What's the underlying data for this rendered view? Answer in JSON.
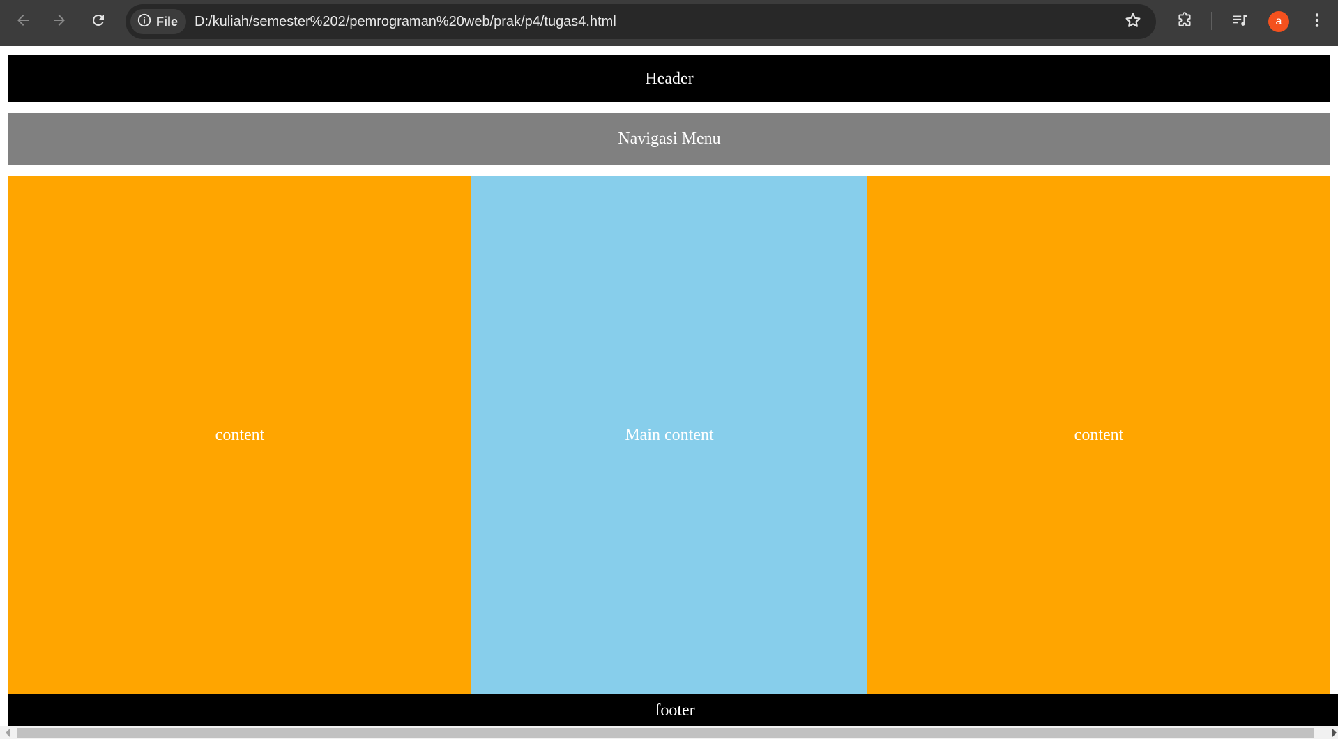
{
  "browser": {
    "site_chip_label": "File",
    "url": "D:/kuliah/semester%202/pemrograman%20web/prak/p4/tugas4.html",
    "avatar_letter": "a",
    "avatar_color": "#f4511e"
  },
  "page": {
    "header_text": "Header",
    "nav_text": "Navigasi Menu",
    "left_content_text": "content",
    "main_content_text": "Main content",
    "right_content_text": "content",
    "footer_text": "footer"
  },
  "colors": {
    "header_bg": "#000000",
    "nav_bg": "#808080",
    "side_content_bg": "#ffa500",
    "main_content_bg": "#87ceeb",
    "footer_bg": "#000000"
  },
  "icons": {
    "back": "arrow-left-icon",
    "forward": "arrow-right-icon",
    "reload": "reload-icon",
    "site_info": "info-icon",
    "bookmark": "star-icon",
    "extensions": "puzzle-icon",
    "media": "media-queue-icon",
    "menu": "kebab-menu-icon"
  }
}
